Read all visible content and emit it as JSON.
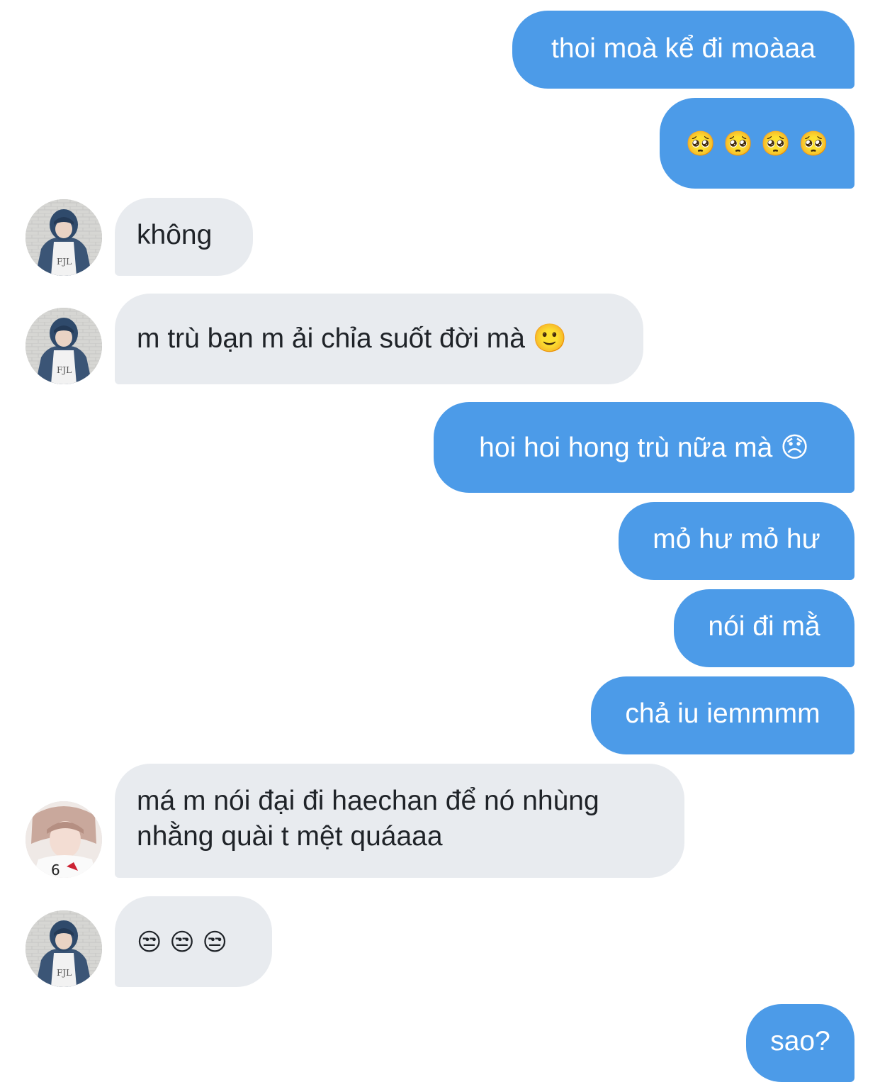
{
  "colors": {
    "outgoing_bubble": "#4c9be8",
    "incoming_bubble": "#e8ebef",
    "outgoing_text": "#ffffff",
    "incoming_text": "#1f2328",
    "background": "#ffffff"
  },
  "messages": [
    {
      "direction": "outgoing",
      "text": "thoi moà kể đi moàaa"
    },
    {
      "direction": "outgoing",
      "text": "🥺 🥺 🥺 🥺"
    },
    {
      "direction": "incoming",
      "avatar": "avatar-blue-hood",
      "text": "không"
    },
    {
      "direction": "incoming",
      "avatar": "avatar-blue-hood",
      "text": "m trù bạn m ải chỉa suốt đời mà 🙂"
    },
    {
      "direction": "outgoing",
      "text": "hoi hoi hong trù nữa mà 😞"
    },
    {
      "direction": "outgoing",
      "text": "mỏ hư mỏ hư"
    },
    {
      "direction": "outgoing",
      "text": "nói đi mằ"
    },
    {
      "direction": "outgoing",
      "text": "chả iu iemmmm"
    },
    {
      "direction": "incoming",
      "avatar": "avatar-bright",
      "text_line1": "má m nói đại đi haechan để nó nhùng",
      "text_line2": "nhằng quài t mệt quáaaa"
    },
    {
      "direction": "incoming",
      "avatar": "avatar-blue-hood",
      "text": "😒 😒 😒"
    },
    {
      "direction": "outgoing",
      "text": "sao?"
    }
  ]
}
